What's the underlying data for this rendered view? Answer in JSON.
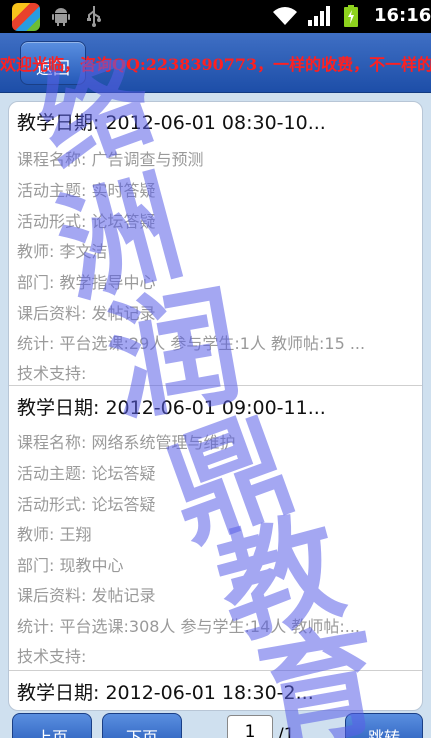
{
  "statusbar": {
    "time": "16:16"
  },
  "header": {
    "back_label": "返回",
    "marquee": "欢迎光临，咨询QQ:2238390773，一样的收费，不一样的服务！"
  },
  "records": [
    {
      "date_label": "教学日期:",
      "date": "2012-06-01  08:30-10...",
      "fields": [
        {
          "label": "课程名称:",
          "value": "广告调查与预测"
        },
        {
          "label": "活动主题:",
          "value": "实时答疑"
        },
        {
          "label": "活动形式:",
          "value": "论坛答疑"
        },
        {
          "label": "教师:",
          "value": "李文洁"
        },
        {
          "label": "部门:",
          "value": "教学指导中心"
        },
        {
          "label": "课后资料:",
          "value": "发帖记录"
        },
        {
          "label": "统计:",
          "value": "平台选课:29人 参与学生:1人 教师帖:15 ..."
        },
        {
          "label": "技术支持:",
          "value": ""
        }
      ]
    },
    {
      "date_label": "教学日期:",
      "date": "2012-06-01  09:00-11...",
      "fields": [
        {
          "label": "课程名称:",
          "value": "网络系统管理与维护"
        },
        {
          "label": "活动主题:",
          "value": "论坛答疑"
        },
        {
          "label": "活动形式:",
          "value": "论坛答疑"
        },
        {
          "label": "教师:",
          "value": "王翔"
        },
        {
          "label": "部门:",
          "value": "现教中心"
        },
        {
          "label": "课后资料:",
          "value": "发帖记录"
        },
        {
          "label": "统计:",
          "value": "平台选课:308人 参与学生:14人 教师帖:..."
        },
        {
          "label": "技术支持:",
          "value": ""
        }
      ]
    },
    {
      "date_label": "教学日期:",
      "date": "2012-06-01    18:30-2...",
      "fields": []
    }
  ],
  "pager": {
    "prev_label": "上页",
    "next_label": "下页",
    "current_page": "1",
    "total": "/1",
    "jump_label": "跳转"
  },
  "watermark": {
    "chars": [
      "络",
      "洲",
      "润",
      "鼎",
      "教",
      "育"
    ],
    "color": "#5a5ee8"
  }
}
